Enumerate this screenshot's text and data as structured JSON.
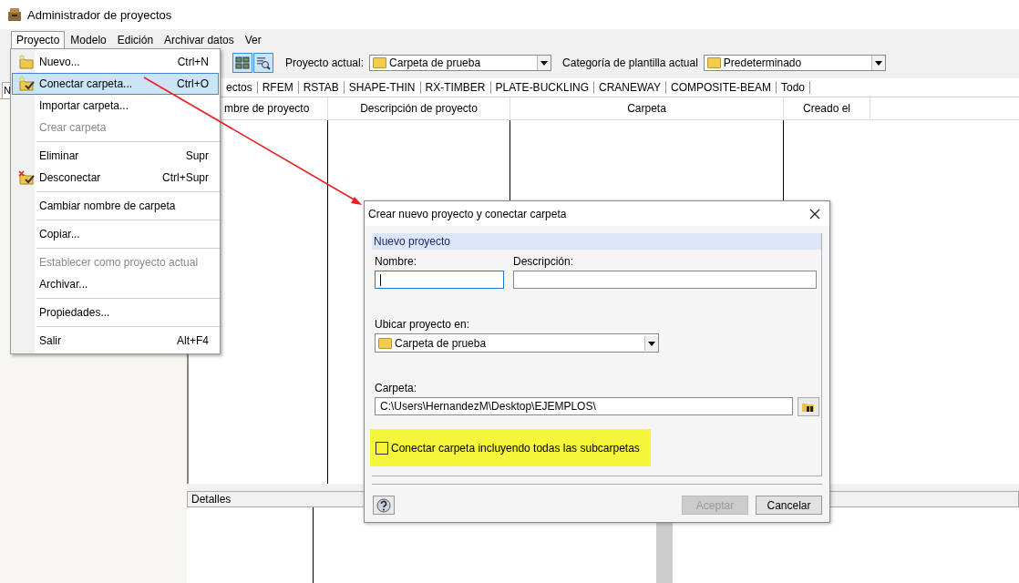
{
  "window": {
    "title": "Administrador de proyectos"
  },
  "menubar": [
    {
      "label": "Proyecto",
      "selected": true
    },
    {
      "label": "Modelo",
      "selected": false
    },
    {
      "label": "Edición",
      "selected": false
    },
    {
      "label": "Archivar datos",
      "selected": false
    },
    {
      "label": "Ver",
      "selected": false
    }
  ],
  "toolbar": {
    "current_project_label": "Proyecto actual:",
    "current_project": "Carpeta de prueba",
    "template_label": "Categoría de plantilla actual",
    "template": "Predeterminado"
  },
  "left_panel": {
    "tab": "N"
  },
  "program_tabs": [
    "ectos",
    "RFEM",
    "RSTAB",
    "SHAPE-THIN",
    "RX-TIMBER",
    "PLATE-BUCKLING",
    "CRANEWAY",
    "COMPOSITE-BEAM",
    "Todo"
  ],
  "table": {
    "columns": [
      "mbre de proyecto",
      "Descripción de proyecto",
      "Carpeta",
      "Creado el"
    ]
  },
  "details": {
    "title": "Detalles"
  },
  "menu": {
    "items": [
      {
        "kind": "new",
        "label": "Nuevo...",
        "shortcut": "Ctrl+N",
        "disabled": false,
        "selected": false
      },
      {
        "kind": "connect",
        "label": "Conectar carpeta...",
        "shortcut": "Ctrl+O",
        "disabled": false,
        "selected": true
      },
      {
        "kind": "plain",
        "label": "Importar carpeta...",
        "disabled": false,
        "selected": false
      },
      {
        "kind": "plain",
        "label": "Crear carpeta",
        "disabled": true,
        "selected": false
      },
      {
        "kind": "separator"
      },
      {
        "kind": "plain",
        "label": "Eliminar",
        "shortcut": "Supr",
        "disabled": false,
        "selected": false
      },
      {
        "kind": "disconnect",
        "label": "Desconectar",
        "shortcut": "Ctrl+Supr",
        "disabled": false,
        "selected": false
      },
      {
        "kind": "separator"
      },
      {
        "kind": "plain",
        "label": "Cambiar nombre de carpeta",
        "disabled": false,
        "selected": false
      },
      {
        "kind": "separator"
      },
      {
        "kind": "plain",
        "label": "Copiar...",
        "disabled": false,
        "selected": false
      },
      {
        "kind": "separator"
      },
      {
        "kind": "plain",
        "label": "Establecer como proyecto actual",
        "disabled": true,
        "selected": false
      },
      {
        "kind": "plain",
        "label": "Archivar...",
        "disabled": false,
        "selected": false
      },
      {
        "kind": "separator"
      },
      {
        "kind": "plain",
        "label": "Propiedades...",
        "disabled": false,
        "selected": false
      },
      {
        "kind": "separator"
      },
      {
        "kind": "plain",
        "label": "Salir",
        "shortcut": "Alt+F4",
        "disabled": false,
        "selected": false
      }
    ]
  },
  "dialog": {
    "title": "Crear nuevo proyecto y conectar carpeta",
    "section": "Nuevo proyecto",
    "name_label": "Nombre:",
    "name_field": {
      "focused": true
    },
    "description_label": "Descripción:",
    "location_label": "Ubicar proyecto en:",
    "location": "Carpeta de prueba",
    "folder_label": "Carpeta:",
    "folder": "C:\\Users\\HernandezM\\Desktop\\EJEMPLOS\\",
    "subfolders": {
      "label": "Conectar carpeta incluyendo todas las subcarpetas",
      "checked": false
    },
    "buttons": [
      {
        "label": "Aceptar",
        "disabled": true
      },
      {
        "label": "Cancelar",
        "disabled": false
      }
    ]
  }
}
